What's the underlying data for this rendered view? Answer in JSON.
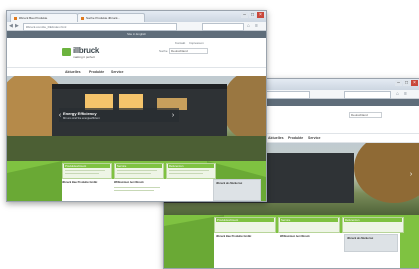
{
  "window_front": {
    "tabs": [
      {
        "label": "illbruck Bau Produkte"
      },
      {
        "label": "Suche Produkte illbruck..."
      }
    ],
    "url": "illbruck.com/de_DE/index.html",
    "controls": {
      "minimize": "–",
      "maximize": "□",
      "close": "×"
    }
  },
  "window_back": {
    "controls": {
      "minimize": "–",
      "maximize": "□",
      "close": "×"
    }
  },
  "site": {
    "util_bar": "Site in English",
    "logo_text": "illbruck",
    "logo_tagline": "making it perfect",
    "header_links": [
      "Kontakt",
      "Impressum"
    ],
    "country_select": "Deutschland",
    "search_label": "Suche",
    "nav": [
      "Aktuelles",
      "Produkte",
      "Service"
    ],
    "hero_caption_title": "Energy Efficiency",
    "hero_caption_sub": "Mit uns sind Sie energieeffizient",
    "boxes": [
      {
        "title": "Produktsortiment"
      },
      {
        "title": "Service"
      },
      {
        "title": "Referenzen"
      }
    ],
    "lower_left_title": "illbruck Bau Produkte GmbH",
    "lower_mid_title": "Willkommen bei illbruck",
    "lower_right_title": "illbruck als Marke bei",
    "back_nav": [
      "Aktuelles",
      "Produkte",
      "Service"
    ]
  },
  "colors": {
    "brand_green": "#7fc241",
    "util_bar": "#5f6d7a",
    "caption_bg": "#2d3237"
  }
}
